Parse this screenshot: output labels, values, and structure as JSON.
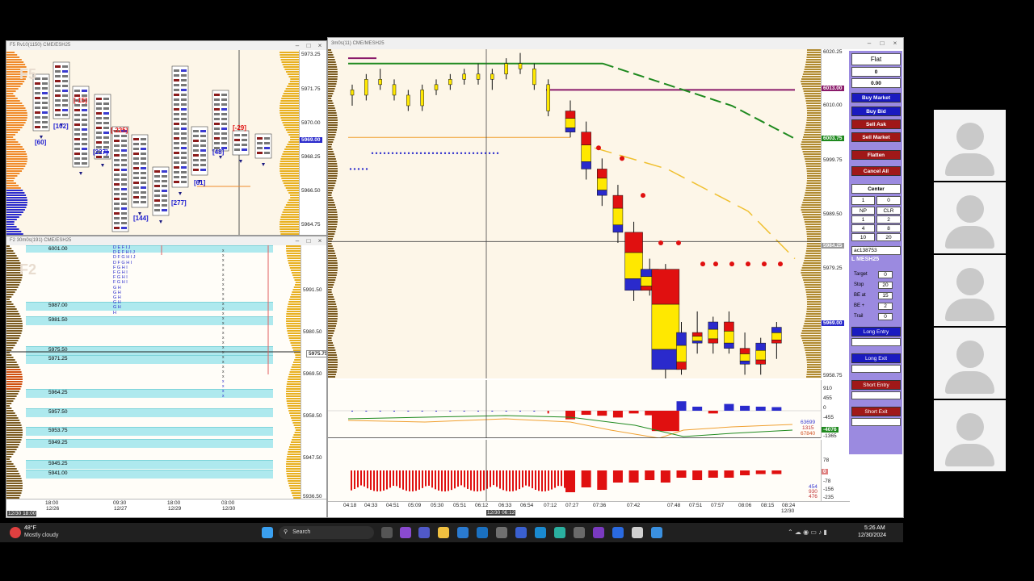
{
  "win_f5": {
    "title": "F5 Rv10(1150) CME/ESH25",
    "watermark": "F5",
    "axis": [
      "5973.25",
      "5971.75",
      "5970.00",
      "5968.25",
      "5966.50",
      "5964.75"
    ],
    "price_tag": "5969.00",
    "deltas": [
      {
        "text": "[60]",
        "color": "#1a1ad0"
      },
      {
        "text": "[102]",
        "color": "#1a1ad0"
      },
      {
        "text": "[-15]",
        "color": "#e01010"
      },
      {
        "text": "[227]",
        "color": "#1a1ad0"
      },
      {
        "text": "[-225]",
        "color": "#e01010"
      },
      {
        "text": "[144]",
        "color": "#1a1ad0"
      },
      {
        "text": "[277]",
        "color": "#1a1ad0"
      },
      {
        "text": "[61]",
        "color": "#1a1ad0"
      },
      {
        "text": "[48]",
        "color": "#1a1ad0"
      },
      {
        "text": "[-29]",
        "color": "#e01010"
      }
    ]
  },
  "win_f2": {
    "title": "F2 30m0s(191) CME/ESH25",
    "watermark": "F2",
    "bands": [
      "6001.00",
      "5987.00",
      "5981.50",
      "5975.50",
      "5971.25",
      "5964.25",
      "5957.50",
      "5953.75",
      "5949.25",
      "5945.25",
      "5941.00"
    ],
    "axis": [
      "5991.50",
      "5980.50",
      "5969.50",
      "5958.50",
      "5947.50",
      "5936.50"
    ],
    "price_tag": "5975.75",
    "x_labels": [
      {
        "t": "18:00",
        "d": "12/26"
      },
      {
        "t": "09:30",
        "d": "12/27"
      },
      {
        "t": "18:00",
        "d": "12/29"
      },
      {
        "t": "03:00",
        "d": "12/30"
      }
    ],
    "cursor_label": "12/30 18:00",
    "tpo_rows": [
      "D E F I J",
      "D E F H I J",
      "D F G H I J",
      "D F G H I",
      "F G H I",
      "F G H I",
      "F G H I",
      "F G H I",
      "G H",
      "G H",
      "G H",
      "G H",
      "G H",
      "H"
    ]
  },
  "win_main": {
    "title": "3m0s(11) CME/MESH25",
    "axis": [
      "6020.25",
      "6010.00",
      "5999.75",
      "5989.50",
      "5979.25",
      "5969.00",
      "5958.75"
    ],
    "tags": [
      {
        "text": "6013.00",
        "color": "#8a1a6a"
      },
      {
        "text": "6003.75",
        "color": "#1f8a1f"
      },
      {
        "text": "5984.25",
        "color": "#9a9a9a"
      },
      {
        "text": "5969.00",
        "color": "#2a2acc"
      }
    ],
    "osc_axis": [
      "910",
      "455",
      "0",
      "-455",
      "-910",
      "-1365"
    ],
    "osc_values": [
      "63699",
      "1315",
      "67840"
    ],
    "osc_tag": "-4076",
    "vol_axis": [
      "78",
      "0",
      "-78",
      "-156",
      "-235"
    ],
    "vol_values": [
      "454",
      "930",
      "476"
    ],
    "x_labels": [
      "04:18",
      "04:33",
      "04:51",
      "05:09",
      "05:30",
      "05:51",
      "06:12",
      "06:33",
      "06:54",
      "07:12",
      "07:27",
      "07:36",
      "07:42",
      "07:48",
      "07:51",
      "07:57",
      "08:06",
      "08:15",
      "08:24"
    ],
    "x_date": "12/30",
    "cursor_label": "12/30 06:12",
    "candles": [
      {
        "o": 6013,
        "h": 6014,
        "l": 6010,
        "c": 6012
      },
      {
        "o": 6012,
        "h": 6016,
        "l": 6011,
        "c": 6015
      },
      {
        "o": 6015,
        "h": 6017,
        "l": 6013,
        "c": 6014
      },
      {
        "o": 6014,
        "h": 6015,
        "l": 6011,
        "c": 6012
      },
      {
        "o": 6012,
        "h": 6013,
        "l": 6009,
        "c": 6010
      },
      {
        "o": 6010,
        "h": 6014,
        "l": 6009,
        "c": 6013
      },
      {
        "o": 6013,
        "h": 6015,
        "l": 6012,
        "c": 6014
      },
      {
        "o": 6014,
        "h": 6016,
        "l": 6013,
        "c": 6015
      },
      {
        "o": 6015,
        "h": 6017,
        "l": 6014,
        "c": 6016
      },
      {
        "o": 6016,
        "h": 6018,
        "l": 6014,
        "c": 6015
      },
      {
        "o": 6015,
        "h": 6017,
        "l": 6013,
        "c": 6016
      },
      {
        "o": 6016,
        "h": 6019,
        "l": 6015,
        "c": 6018
      },
      {
        "o": 6018,
        "h": 6020,
        "l": 6016,
        "c": 6017
      },
      {
        "o": 6017,
        "h": 6018,
        "l": 6013,
        "c": 6014
      },
      {
        "o": 6014,
        "h": 6015,
        "l": 6008,
        "c": 6009
      },
      {
        "o": 6009,
        "h": 6011,
        "l": 6004,
        "c": 6005
      },
      {
        "o": 6005,
        "h": 6007,
        "l": 5996,
        "c": 5998
      },
      {
        "o": 5998,
        "h": 6000,
        "l": 5991,
        "c": 5993
      },
      {
        "o": 5993,
        "h": 5995,
        "l": 5984,
        "c": 5986
      },
      {
        "o": 5986,
        "h": 5988,
        "l": 5973,
        "c": 5975
      },
      {
        "o": 5975,
        "h": 5981,
        "l": 5974,
        "c": 5979
      },
      {
        "o": 5979,
        "h": 5980,
        "l": 5958,
        "c": 5960
      },
      {
        "o": 5960,
        "h": 5969,
        "l": 5959,
        "c": 5967
      },
      {
        "o": 5967,
        "h": 5971,
        "l": 5963,
        "c": 5965
      },
      {
        "o": 5965,
        "h": 5970,
        "l": 5963,
        "c": 5969
      },
      {
        "o": 5969,
        "h": 5971,
        "l": 5963,
        "c": 5964
      },
      {
        "o": 5964,
        "h": 5967,
        "l": 5959,
        "c": 5961
      },
      {
        "o": 5961,
        "h": 5966,
        "l": 5959,
        "c": 5965
      },
      {
        "o": 5965,
        "h": 5969,
        "l": 5962,
        "c": 5968
      }
    ],
    "osc_bars": [
      0,
      0,
      0,
      0,
      0,
      0,
      0,
      0,
      0,
      0,
      0,
      0,
      0,
      0,
      -120,
      -380,
      -180,
      -220,
      -300,
      -120,
      -200,
      -900,
      420,
      180,
      -120,
      300,
      220,
      180,
      160
    ],
    "vol_bars": [
      -500,
      -500,
      -500,
      -500,
      -500,
      -500,
      -500,
      -500,
      -500,
      -500,
      -500,
      -500,
      -500,
      -500,
      -600,
      -900,
      -700,
      -800,
      -500,
      -500,
      -400,
      -500,
      -300,
      -400,
      -300,
      -300,
      -200,
      -150,
      -150
    ]
  },
  "order_panel": {
    "position": "Flat",
    "qty": "0",
    "pnl": "0.00",
    "buy_market": "Buy Market",
    "buy_bid": "Buy Bid",
    "sell_ask": "Sell Ask",
    "sell_market": "Sell Market",
    "flatten": "Flatten",
    "cancel_all": "Cancel All",
    "center": "Center",
    "qty_input": "1",
    "qty_right": "0",
    "np": "NP",
    "clr": "CLR",
    "presets": [
      [
        "1",
        "2"
      ],
      [
        "4",
        "8"
      ],
      [
        "10",
        "20"
      ]
    ],
    "account": "ac138753",
    "symbol": "L MESH25",
    "target_label": "Target",
    "target_val": "0",
    "stop_label": "Stop",
    "stop_val": "20",
    "be_at_label": "BE at",
    "be_at_val": "15",
    "be_plus_label": "BE +",
    "be_plus_val": "2",
    "trail_label": "Trail",
    "trail_val": "0",
    "long_entry": "Long Entry",
    "long_exit": "Long Exit",
    "short_entry": "Short Entry",
    "short_exit": "Short Exit"
  },
  "taskbar": {
    "temp": "48°F",
    "weather": "Mostly cloudy",
    "search": "Search",
    "time": "5:26 AM",
    "date": "12/30/2024"
  }
}
